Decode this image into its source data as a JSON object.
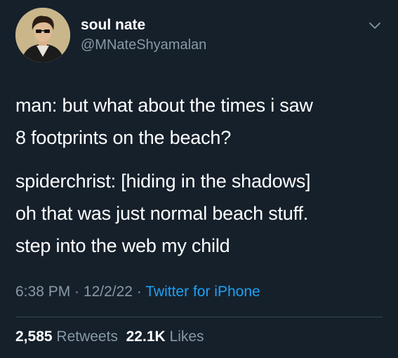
{
  "user": {
    "display_name": "soul nate",
    "handle": "@MNateShyamalan"
  },
  "tweet": {
    "paragraph1": [
      "man: but what about the times i saw",
      "8 footprints on the beach?"
    ],
    "paragraph2": [
      "spiderchrist: [hiding in the shadows]",
      "oh that was just normal beach stuff.",
      "step into the web my child"
    ]
  },
  "meta": {
    "time": "6:38 PM",
    "sep1": " · ",
    "date": "12/2/22",
    "sep2": " · ",
    "source": "Twitter for iPhone"
  },
  "stats": {
    "retweets_count": "2,585",
    "retweets_label": "Retweets",
    "likes_count": "22.1K",
    "likes_label": "Likes"
  },
  "icons": {
    "menu": "chevron-down-icon",
    "avatar": "avatar"
  },
  "colors": {
    "background": "#15202b",
    "text": "#ffffff",
    "secondary": "#8899a6",
    "link": "#1da1f2",
    "divider": "#38444d"
  }
}
